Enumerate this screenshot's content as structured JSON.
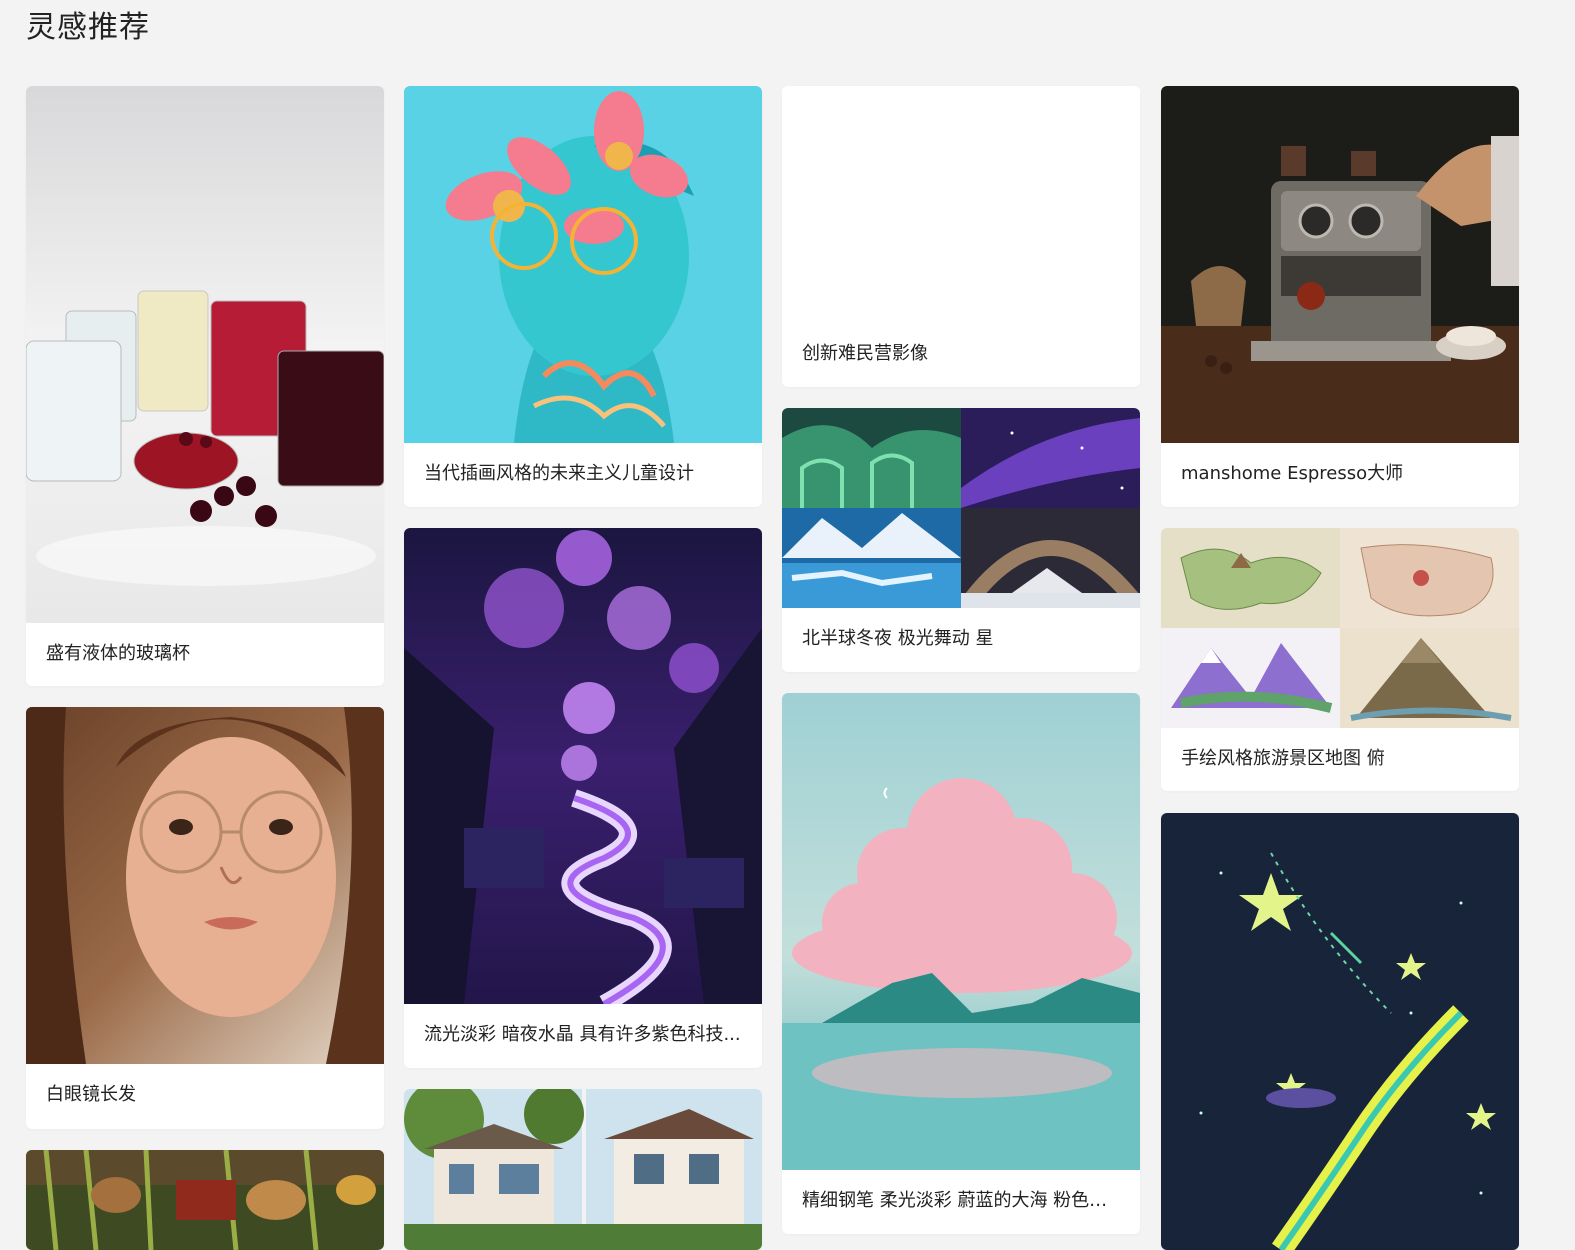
{
  "page": {
    "title": "灵感推荐"
  },
  "cards": {
    "glass_cups": {
      "caption": "盛有液体的玻璃杯",
      "image": "glass-cups-image"
    },
    "flower_child": {
      "caption": "当代插画风格的未来主义儿童设计",
      "image": "flower-child-image"
    },
    "refugee_camp": {
      "caption": "创新难民营影像",
      "image": "blank-image"
    },
    "espresso": {
      "caption": "manshome Espresso大师",
      "image": "espresso-machine-image"
    },
    "aurora": {
      "caption": "北半球冬夜 极光舞动 星",
      "image": "aurora-grid-image"
    },
    "travel_map": {
      "caption": "手绘风格旅游景区地图 俯",
      "image": "map-grid-image"
    },
    "glasses_girl": {
      "caption": "白眼镜长发",
      "image": "girl-portrait-image"
    },
    "purple_crystal": {
      "caption": "流光淡彩 暗夜水晶 具有许多紫色科技...",
      "image": "purple-landscape-image"
    },
    "pink_clouds": {
      "caption": "精细钢笔 柔光淡彩 蔚蓝的大海 粉色的云",
      "image": "cloud-sea-image"
    },
    "night_stars": {
      "caption": "",
      "image": "shooting-stars-image"
    },
    "jungle": {
      "caption": "",
      "image": "jungle-image"
    },
    "villa": {
      "caption": "",
      "image": "villa-image"
    }
  }
}
